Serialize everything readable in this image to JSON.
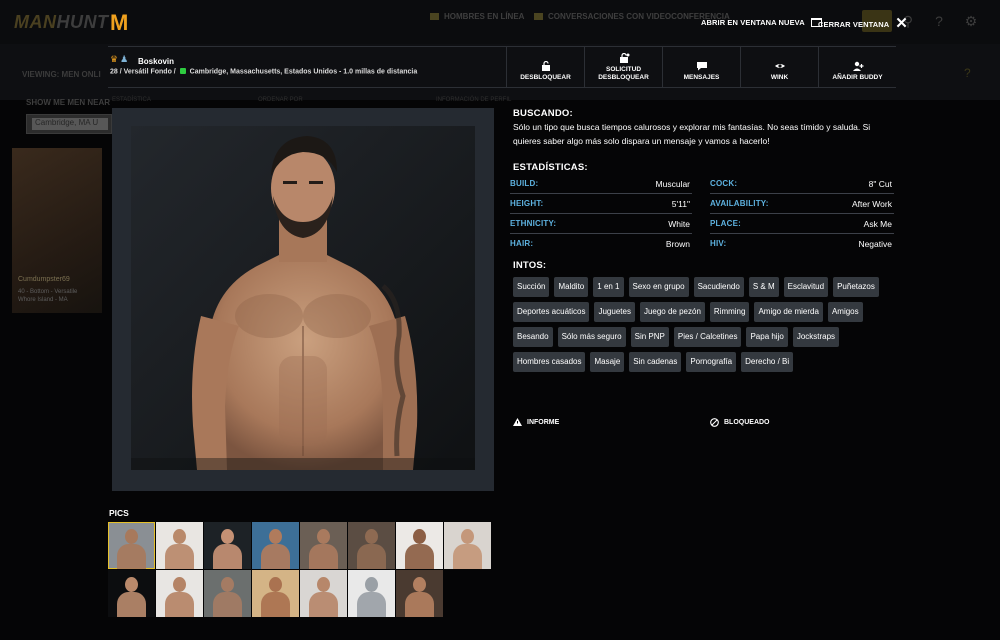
{
  "background": {
    "logo_prefix": "MAN",
    "logo_suffix": "HUNT",
    "nav_online": "HOMBRES EN LÍNEA",
    "nav_video": "CONVERSACIONES CON VIDEOCONFERENCIA",
    "viewing": "VIEWING: MEN ONLI",
    "show_me": "SHOW ME MEN NEAR",
    "location": "Cambridge, MA U",
    "col_estadistica": "ESTADÍSTICA",
    "col_ordenar": "ORDENAR POR",
    "col_info": "INFORMACIÓN DE PERFIL",
    "card_name": "Cumdumpster69",
    "card_info_1": "40 - Bottom - Versatile",
    "card_info_2": "Whore Island - MA"
  },
  "modal": {
    "logo_letter": "M",
    "open_new_window": "ABRIR EN VENTANA NUEVA",
    "close_window": "CERRAR VENTANA"
  },
  "profile": {
    "username": "Boskovin",
    "meta_before_dot": "28 / Versátil Fondo /",
    "meta_location": "Cambridge, Massachusetts, Estados Unidos - 1.0 millas de distancia"
  },
  "actions": [
    {
      "label": "DESBLOQUEAR",
      "icon": "unlock-icon"
    },
    {
      "label": "SOLICITUD DESBLOQUEAR",
      "icon": "unlock-request-icon"
    },
    {
      "label": "MENSAJES",
      "icon": "message-icon"
    },
    {
      "label": "WINK",
      "icon": "wink-icon"
    },
    {
      "label": "AÑADIR BUDDY",
      "icon": "add-buddy-icon"
    }
  ],
  "looking_for": {
    "title": "BUSCANDO:",
    "text": "Sólo un tipo que busca tiempos calurosos y explorar mis fantasías. No seas tímido y saluda. Si quieres saber algo más solo dispara un mensaje y vamos a hacerlo!"
  },
  "stats": {
    "title": "ESTADÍSTICAS:",
    "left": [
      {
        "key": "BUILD:",
        "value": "Muscular"
      },
      {
        "key": "HEIGHT:",
        "value": "5'11\""
      },
      {
        "key": "ETHNICITY:",
        "value": "White"
      },
      {
        "key": "HAIR:",
        "value": "Brown"
      }
    ],
    "right": [
      {
        "key": "COCK:",
        "value": "8\" Cut"
      },
      {
        "key": "AVAILABILITY:",
        "value": "After Work"
      },
      {
        "key": "PLACE:",
        "value": "Ask Me"
      },
      {
        "key": "HIV:",
        "value": "Negative"
      }
    ]
  },
  "intos": {
    "title": "INTOS:",
    "tags": [
      "Succión",
      "Maldito",
      "1 en 1",
      "Sexo en grupo",
      "Sacudiendo",
      "S & M",
      "Esclavitud",
      "Puñetazos",
      "Deportes acuáticos",
      "Juguetes",
      "Juego de pezón",
      "Rimming",
      "Amigo de mierda",
      "Amigos",
      "Besando",
      "Sólo más seguro",
      "Sin PNP",
      "Pies / Calcetines",
      "Papa hijo",
      "Jockstraps",
      "Hombres casados",
      "Masaje",
      "Sin cadenas",
      "Pornografía",
      "Derecho / Bi"
    ]
  },
  "links": {
    "report": "INFORME",
    "blocked": "BLOQUEADO"
  },
  "pics": {
    "title": "PICS",
    "selected_index": 0,
    "thumbs": [
      {
        "bg": "#8a8f94",
        "skin": "#a7795c"
      },
      {
        "bg": "#e9e6e2",
        "skin": "#b9896a"
      },
      {
        "bg": "#1d2226",
        "skin": "#c59174"
      },
      {
        "bg": "#3d6f97",
        "skin": "#b07b5c"
      },
      {
        "bg": "#6b5f55",
        "skin": "#a97a5e"
      },
      {
        "bg": "#5b4d43",
        "skin": "#8e6a52"
      },
      {
        "bg": "#ece9e6",
        "skin": "#8c5e44"
      },
      {
        "bg": "#d9d4cf",
        "skin": "#c4977a"
      },
      {
        "bg": "#0c0d0f",
        "skin": "#b9896b"
      },
      {
        "bg": "#e8e6e3",
        "skin": "#b58466"
      },
      {
        "bg": "#6b6f6e",
        "skin": "#a47b63"
      },
      {
        "bg": "#d4b486",
        "skin": "#aa7250"
      },
      {
        "bg": "#d9d6d3",
        "skin": "#b7876a"
      },
      {
        "bg": "#e9e9e9",
        "skin": "#9aa0a6"
      },
      {
        "bg": "#4a3a30",
        "skin": "#b27f60"
      }
    ]
  }
}
